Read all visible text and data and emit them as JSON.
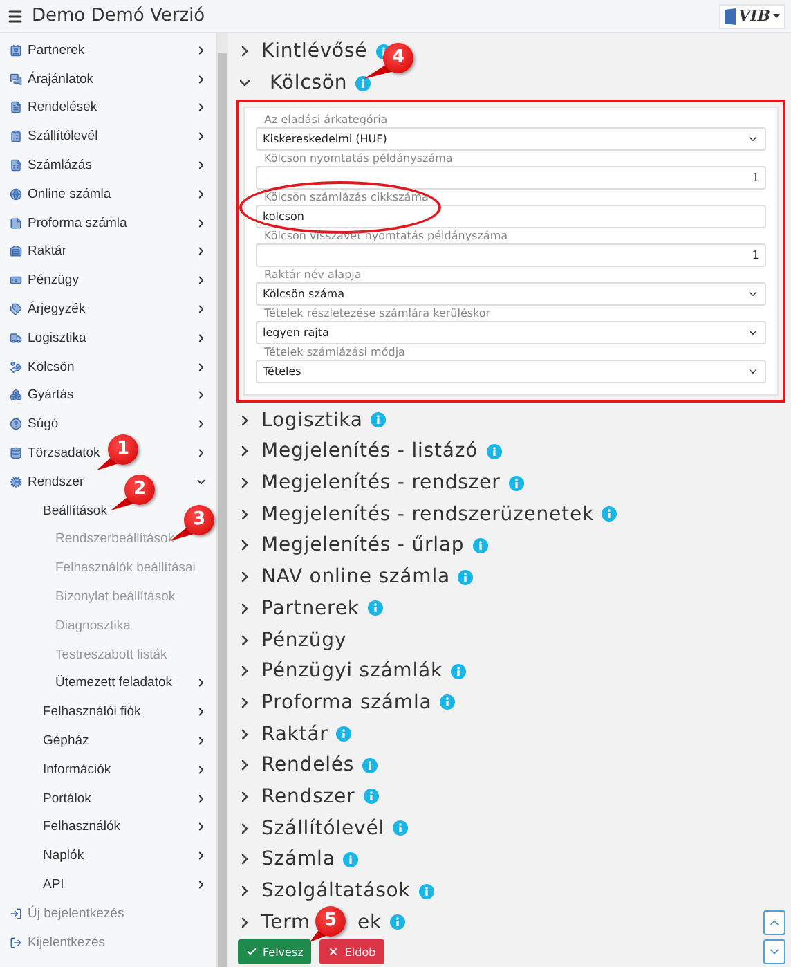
{
  "header": {
    "title": "Demo Demó Verzió",
    "logo_text": "VIB"
  },
  "sidebar": {
    "items": [
      {
        "label": "Partnerek",
        "expanded": false
      },
      {
        "label": "Árajánlatok",
        "expanded": false
      },
      {
        "label": "Rendelések",
        "expanded": false
      },
      {
        "label": "Szállítólevél",
        "expanded": false
      },
      {
        "label": "Számlázás",
        "expanded": false
      },
      {
        "label": "Online számla",
        "expanded": false
      },
      {
        "label": "Proforma számla",
        "expanded": false
      },
      {
        "label": "Raktár",
        "expanded": false
      },
      {
        "label": "Pénzügy",
        "expanded": false
      },
      {
        "label": "Árjegyzék",
        "expanded": false
      },
      {
        "label": "Logisztika",
        "expanded": false
      },
      {
        "label": "Kölcsön",
        "expanded": false
      },
      {
        "label": "Gyártás",
        "expanded": false
      },
      {
        "label": "Súgó",
        "expanded": false
      },
      {
        "label": "Törzsadatok",
        "expanded": false
      },
      {
        "label": "Rendszer",
        "expanded": true,
        "children": [
          {
            "label": "Beállítások",
            "children": [
              {
                "label": "Rendszerbeállítások"
              },
              {
                "label": "Felhasználók beállításai"
              },
              {
                "label": "Bizonylat beállítások"
              },
              {
                "label": "Diagnosztika"
              },
              {
                "label": "Testreszabott listák"
              },
              {
                "label": "Ütemezett feladatok",
                "expanded": false
              }
            ]
          },
          {
            "label": "Felhasználói fiók",
            "expanded": false
          },
          {
            "label": "Gépház",
            "expanded": false
          },
          {
            "label": "Információk",
            "expanded": false
          },
          {
            "label": "Portálok",
            "expanded": false
          },
          {
            "label": "Felhasználók",
            "expanded": false
          },
          {
            "label": "Naplók",
            "expanded": false
          },
          {
            "label": "API",
            "expanded": false
          }
        ]
      }
    ],
    "footer_items": [
      {
        "label": "Új bejelentkezés"
      },
      {
        "label": "Kijelentkezés"
      }
    ]
  },
  "sections": [
    {
      "title": "Kintlévősé",
      "expanded": false,
      "info": true
    },
    {
      "title": "Kölcsön",
      "expanded": true,
      "info": true,
      "highlighted": true,
      "fields": [
        {
          "kind": "select",
          "label": "Az eladási árkategória",
          "value": "Kiskereskedelmi (HUF)",
          "circled": false
        },
        {
          "kind": "number",
          "label": "Kölcsön nyomtatás példányszáma",
          "value": "1",
          "circled": false
        },
        {
          "kind": "text",
          "label": "Kölcsön számlázás cikkszáma",
          "value": "kolcson",
          "circled": true
        },
        {
          "kind": "number",
          "label": "Kölcsön visszavét nyomtatás példányszáma",
          "value": "1",
          "circled": false
        },
        {
          "kind": "select",
          "label": "Raktár név alapja",
          "value": "Kölcsön száma",
          "circled": false
        },
        {
          "kind": "select",
          "label": "Tételek részletezése számlára kerüléskor",
          "value": "legyen rajta",
          "circled": false
        },
        {
          "kind": "select",
          "label": "Tételek számlázási módja",
          "value": "Tételes",
          "circled": false
        }
      ]
    },
    {
      "title": "Logisztika",
      "expanded": false,
      "info": true
    },
    {
      "title": "Megjelenítés - listázó",
      "expanded": false,
      "info": true
    },
    {
      "title": "Megjelenítés - rendszer",
      "expanded": false,
      "info": true
    },
    {
      "title": "Megjelenítés - rendszerüzenetek",
      "expanded": false,
      "info": true
    },
    {
      "title": "Megjelenítés - űrlap",
      "expanded": false,
      "info": true
    },
    {
      "title": "NAV online számla",
      "expanded": false,
      "info": true
    },
    {
      "title": "Partnerek",
      "expanded": false,
      "info": true
    },
    {
      "title": "Pénzügy",
      "expanded": false,
      "info": false
    },
    {
      "title": "Pénzügyi számlák",
      "expanded": false,
      "info": true
    },
    {
      "title": "Proforma számla",
      "expanded": false,
      "info": true
    },
    {
      "title": "Raktár",
      "expanded": false,
      "info": true
    },
    {
      "title": "Rendelés",
      "expanded": false,
      "info": true
    },
    {
      "title": "Rendszer",
      "expanded": false,
      "info": true
    },
    {
      "title": "Szállítólevél",
      "expanded": false,
      "info": true
    },
    {
      "title": "Számla",
      "expanded": false,
      "info": true
    },
    {
      "title": "Szolgáltatások",
      "expanded": false,
      "info": true
    },
    {
      "title": "Term",
      "title_rest": "ek",
      "expanded": false,
      "info": true
    }
  ],
  "buttons": [
    {
      "kind": "save",
      "label": "Felvesz"
    },
    {
      "kind": "discard",
      "label": "Eldob"
    }
  ],
  "callouts": [
    {
      "label": "1"
    },
    {
      "label": "2"
    },
    {
      "label": "3"
    },
    {
      "label": "4"
    },
    {
      "label": "5"
    }
  ]
}
